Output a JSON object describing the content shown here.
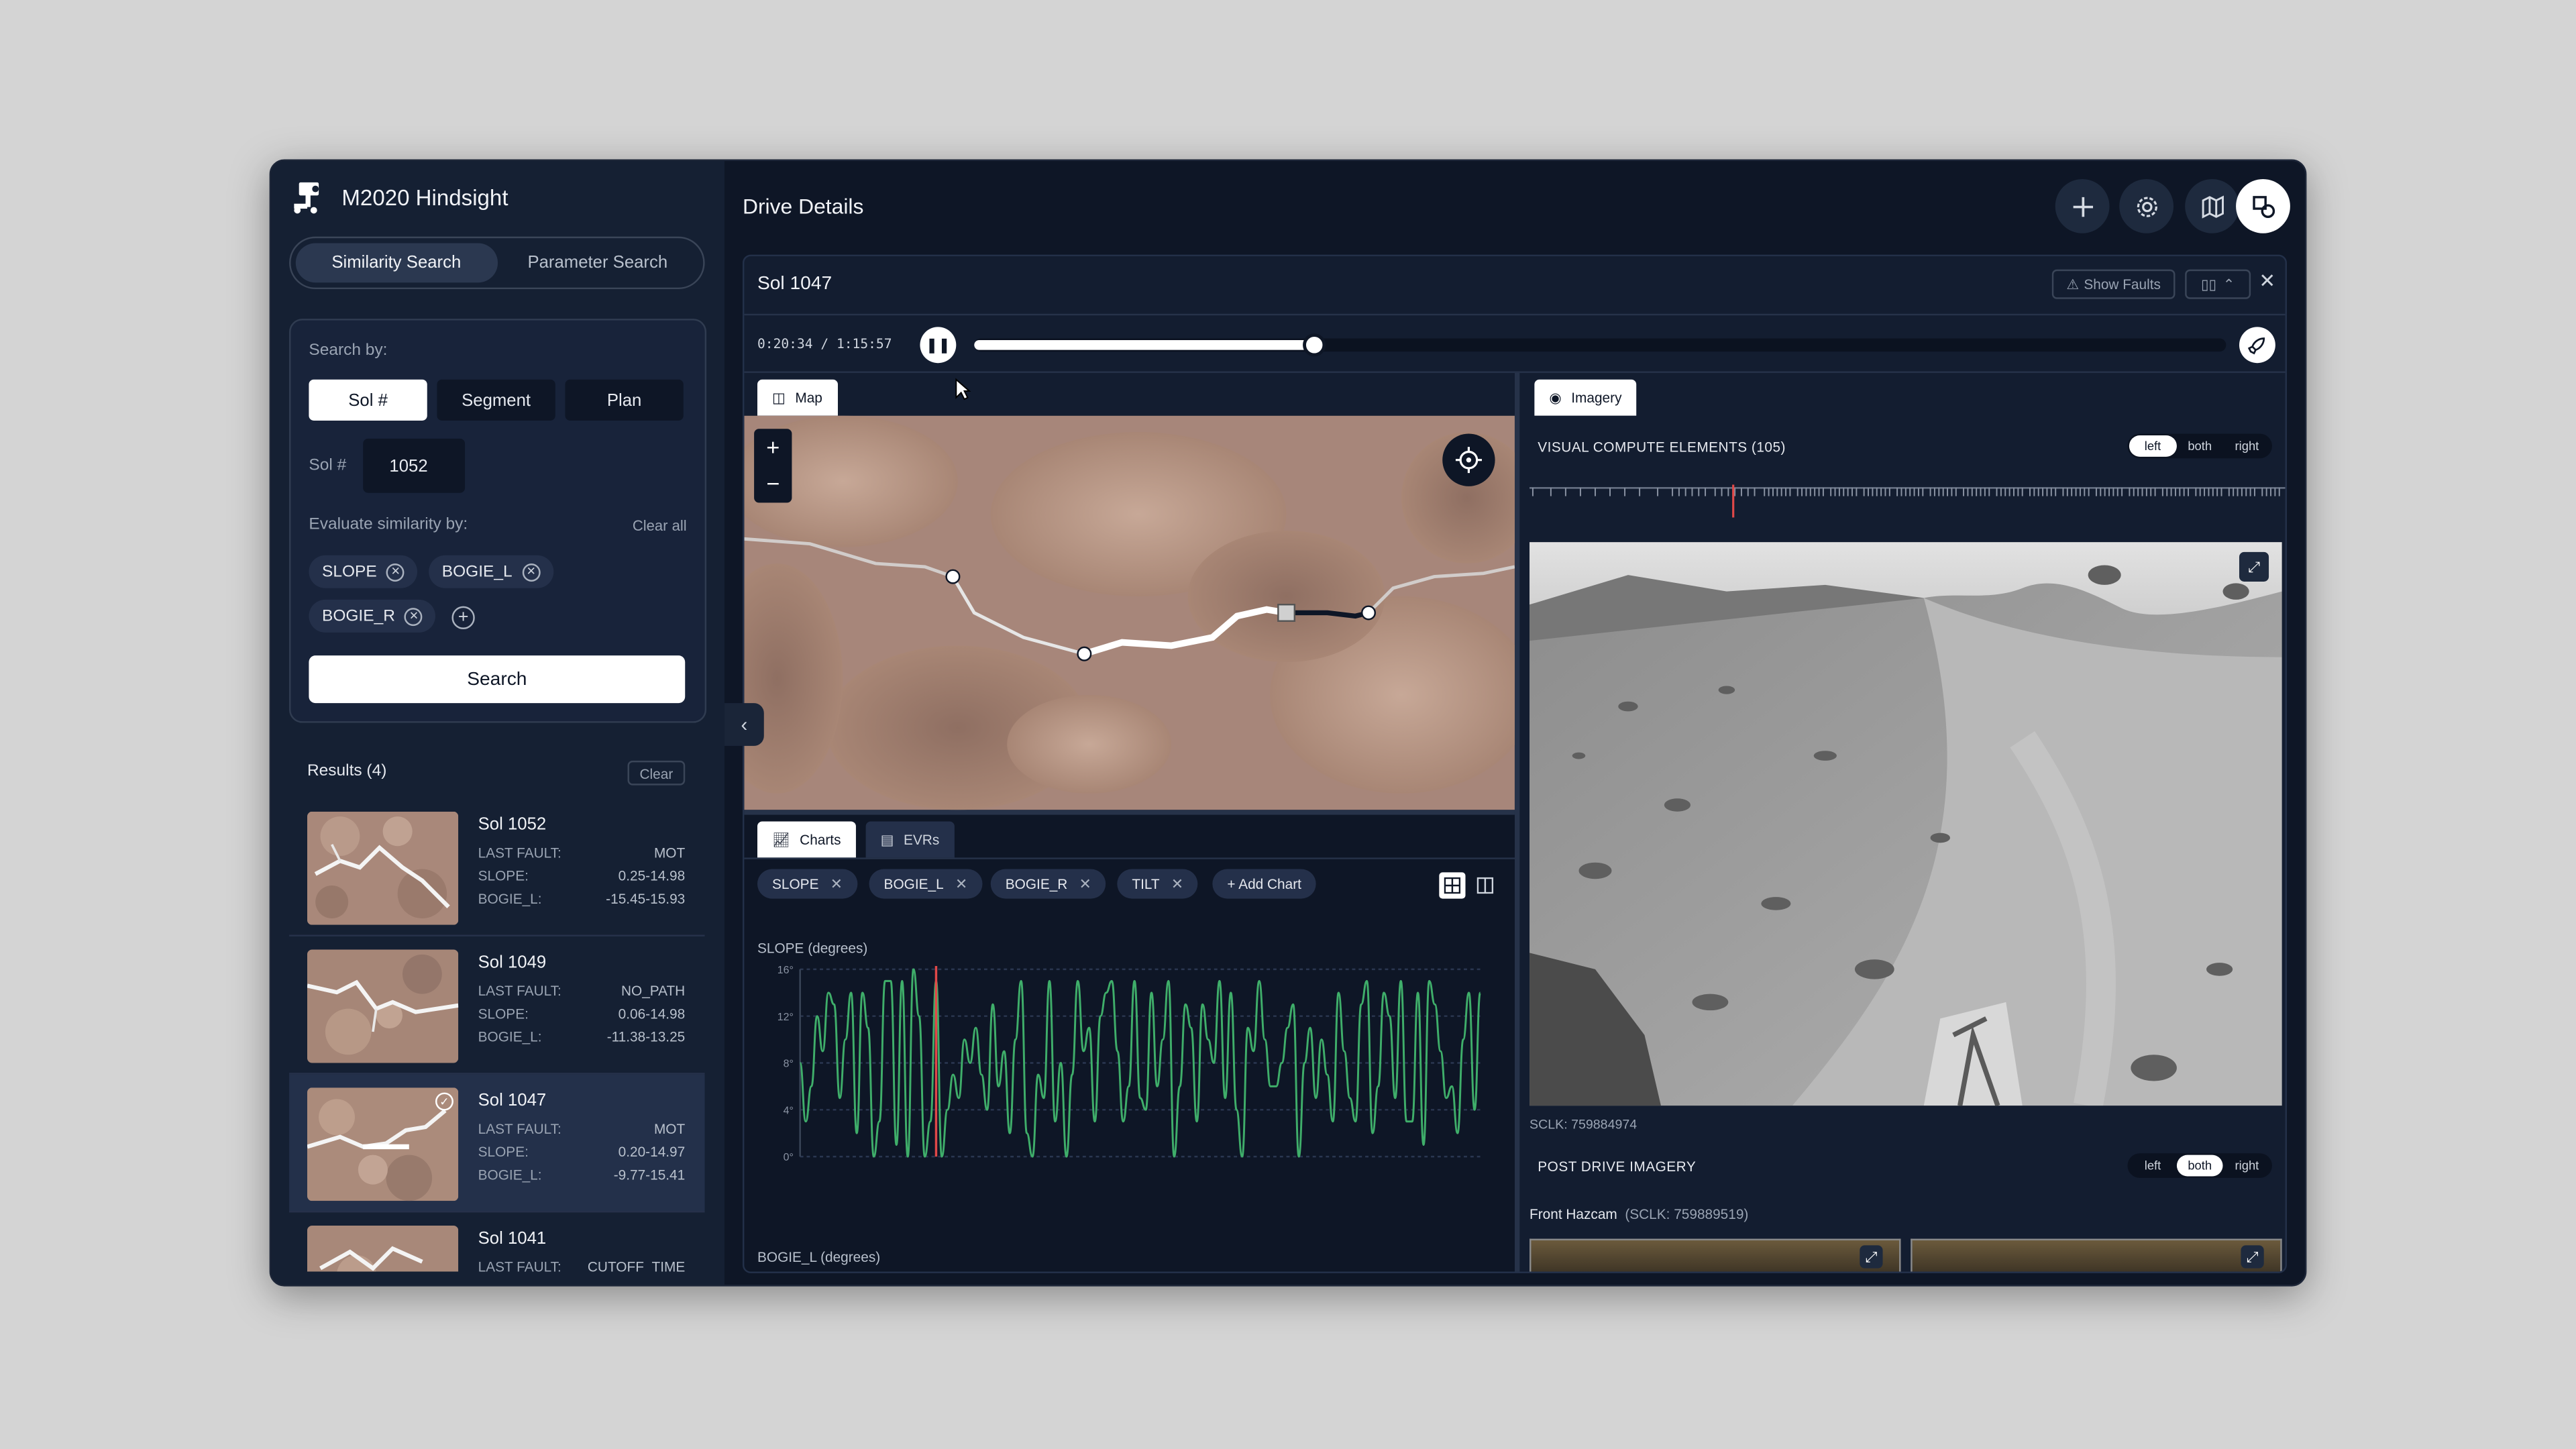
{
  "app": {
    "name": "M2020 Hindsight"
  },
  "sidebar": {
    "mode_tabs": [
      {
        "label": "Similarity Search",
        "active": true
      },
      {
        "label": "Parameter Search",
        "active": false
      }
    ],
    "search_by_label": "Search by:",
    "search_by_tabs": [
      {
        "label": "Sol #",
        "active": true
      },
      {
        "label": "Segment",
        "active": false
      },
      {
        "label": "Plan",
        "active": false
      }
    ],
    "sol_label": "Sol #",
    "sol_value": "1052",
    "evaluate_label": "Evaluate similarity by:",
    "clear_all": "Clear all",
    "chips": [
      "SLOPE",
      "BOGIE_L",
      "BOGIE_R"
    ],
    "search_button": "Search",
    "results_title": "Results (4)",
    "results_clear": "Clear",
    "results": [
      {
        "title": "Sol 1052",
        "fault_label": "LAST FAULT:",
        "fault": "MOT",
        "slope_label": "SLOPE:",
        "slope": "0.25-14.98",
        "bogie_label": "BOGIE_L:",
        "bogie": "-15.45-15.93"
      },
      {
        "title": "Sol 1049",
        "fault_label": "LAST FAULT:",
        "fault": "NO_PATH",
        "slope_label": "SLOPE:",
        "slope": "0.06-14.98",
        "bogie_label": "BOGIE_L:",
        "bogie": "-11.38-13.25"
      },
      {
        "title": "Sol 1047",
        "fault_label": "LAST FAULT:",
        "fault": "MOT",
        "slope_label": "SLOPE:",
        "slope": "0.20-14.97",
        "bogie_label": "BOGIE_L:",
        "bogie": "-9.77-15.41"
      },
      {
        "title": "Sol 1041",
        "fault_label": "LAST FAULT:",
        "fault": "CUTOFF_TIME",
        "slope_label": "SLOPE:",
        "slope": "",
        "bogie_label": "BOGIE_L:",
        "bogie": ""
      }
    ]
  },
  "main": {
    "title": "Drive Details",
    "panel": {
      "title": "Sol 1047",
      "show_faults": "Show Faults",
      "time": "0:20:34 / 1:15:57",
      "progress": 0.271
    },
    "map_tab": "Map",
    "imagery_tab": "Imagery",
    "charts_tab": "Charts",
    "evrs_tab": "EVRs",
    "series_chips": [
      "SLOPE",
      "BOGIE_L",
      "BOGIE_R",
      "TILT"
    ],
    "add_chart": "+ Add Chart",
    "chart1_label": "SLOPE (degrees)",
    "chart2_label": "BOGIE_L (degrees)",
    "vce_label": "VISUAL COMPUTE ELEMENTS (105)",
    "vce_toggle": [
      {
        "label": "left",
        "active": true
      },
      {
        "label": "both",
        "active": false
      },
      {
        "label": "right",
        "active": false
      }
    ],
    "sclk": "SCLK: 759884974",
    "post_label": "POST DRIVE IMAGERY",
    "post_toggle": [
      {
        "label": "left",
        "active": false
      },
      {
        "label": "both",
        "active": true
      },
      {
        "label": "right",
        "active": false
      }
    ],
    "front_hazcam": "Front Hazcam",
    "front_sclk": "(SCLK: 759889519)"
  },
  "colors": {
    "accent_line": "#3fae6a",
    "cursor": "#e04848",
    "bg": "#0e1626"
  },
  "chart_data": {
    "type": "line",
    "title": "SLOPE (degrees)",
    "yticks": [
      "0°",
      "4°",
      "8°",
      "12°",
      "16°"
    ],
    "ylim": [
      0,
      16
    ],
    "cursor_index": 24,
    "values": [
      8,
      3,
      6,
      12,
      9,
      14,
      13,
      5,
      10,
      14,
      2,
      14,
      11,
      0,
      3,
      15,
      15,
      1,
      15,
      0,
      16,
      12,
      0,
      3,
      15,
      0,
      4,
      7,
      5,
      10,
      8,
      11,
      7,
      4,
      13,
      6,
      9,
      2,
      10,
      15,
      2,
      0,
      7,
      5,
      15,
      3,
      8,
      0,
      7,
      15,
      9,
      11,
      3,
      12,
      14,
      15,
      9,
      3,
      6,
      15,
      5,
      4,
      14,
      6,
      10,
      15,
      0,
      6,
      13,
      11,
      3,
      13,
      10,
      8,
      15,
      5,
      14,
      4,
      0,
      11,
      9,
      15,
      10,
      6,
      6,
      8,
      11,
      13,
      0,
      8,
      11,
      5,
      10,
      7,
      3,
      14,
      9,
      5,
      3,
      13,
      15,
      2,
      6,
      14,
      12,
      5,
      15,
      3,
      3,
      14,
      1,
      15,
      13,
      9,
      5,
      6,
      2,
      10,
      14,
      4,
      14
    ]
  }
}
